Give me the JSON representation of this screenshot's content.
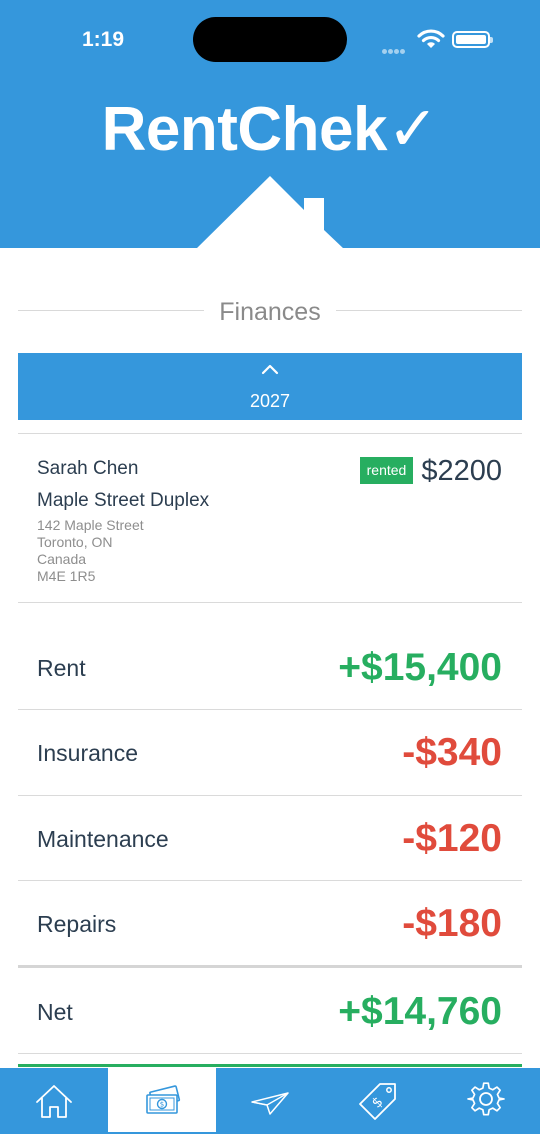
{
  "status_bar": {
    "time": "1:19"
  },
  "header": {
    "app_title": "RentChek✓"
  },
  "section": {
    "title": "Finances"
  },
  "year_selector": {
    "year": "2027"
  },
  "tenant": {
    "name": "Sarah Chen",
    "property": "Maple Street Duplex",
    "address_lines": [
      "142 Maple Street",
      "Toronto, ON",
      "Canada",
      "M4E 1R5"
    ],
    "status": "rented",
    "rent": "$2200"
  },
  "finances": [
    {
      "label": "Rent",
      "value": "+$15,400",
      "sign": "pos"
    },
    {
      "label": "Insurance",
      "value": "-$340",
      "sign": "neg"
    },
    {
      "label": "Maintenance",
      "value": "-$120",
      "sign": "neg"
    },
    {
      "label": "Repairs",
      "value": "-$180",
      "sign": "neg"
    }
  ],
  "net": {
    "label": "Net",
    "value": "+$14,760"
  },
  "tabs": [
    {
      "icon": "home-icon",
      "active": false
    },
    {
      "icon": "money-icon",
      "active": true
    },
    {
      "icon": "paper-plane-icon",
      "active": false
    },
    {
      "icon": "price-tag-icon",
      "active": false
    },
    {
      "icon": "gear-icon",
      "active": false
    }
  ],
  "colors": {
    "brand": "#3597dc",
    "positive": "#27ae60",
    "negative": "#e04b3c",
    "text": "#2c3e50"
  }
}
